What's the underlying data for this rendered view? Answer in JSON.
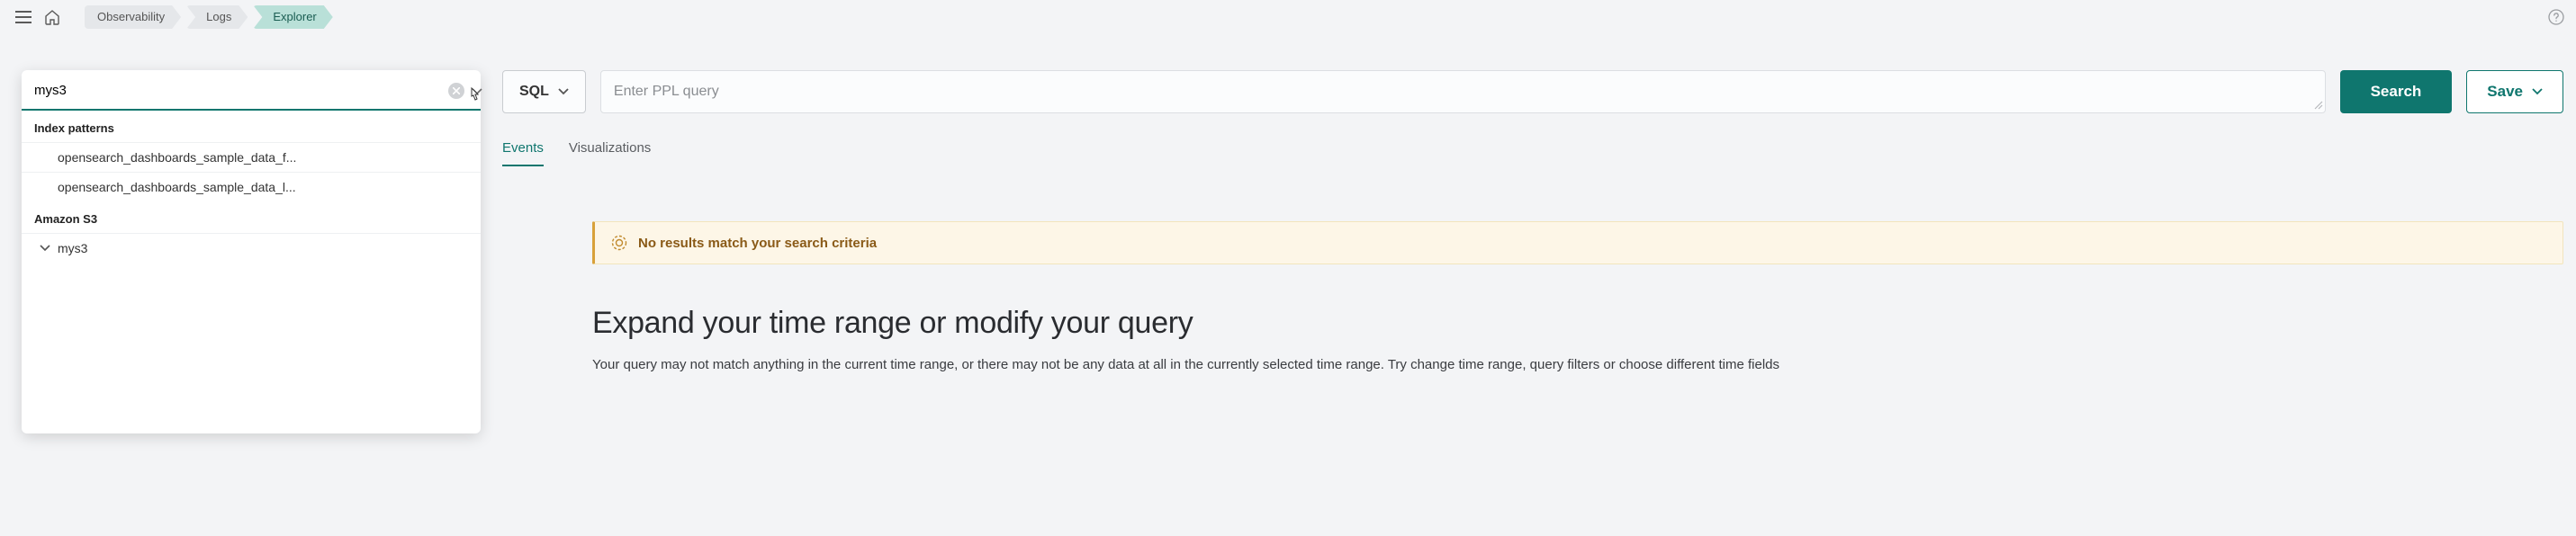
{
  "breadcrumbs": {
    "item1": "Observability",
    "item2": "Logs",
    "item3": "Explorer"
  },
  "dropdown": {
    "search_value": "mys3",
    "section_index_patterns": "Index patterns",
    "options": [
      "opensearch_dashboards_sample_data_f...",
      "opensearch_dashboards_sample_data_l..."
    ],
    "section_amazon_s3": "Amazon S3",
    "tree_item": "mys3"
  },
  "toolbar": {
    "sql_label": "SQL",
    "ppl_placeholder": "Enter PPL query",
    "search_label": "Search",
    "save_label": "Save"
  },
  "tabs": {
    "events": "Events",
    "visualizations": "Visualizations"
  },
  "callout": {
    "text": "No results match your search criteria"
  },
  "empty": {
    "heading": "Expand your time range or modify your query",
    "desc": "Your query may not match anything in the current time range, or there may not be any data at all in the currently selected time range. Try change time range, query filters or choose different time fields"
  }
}
